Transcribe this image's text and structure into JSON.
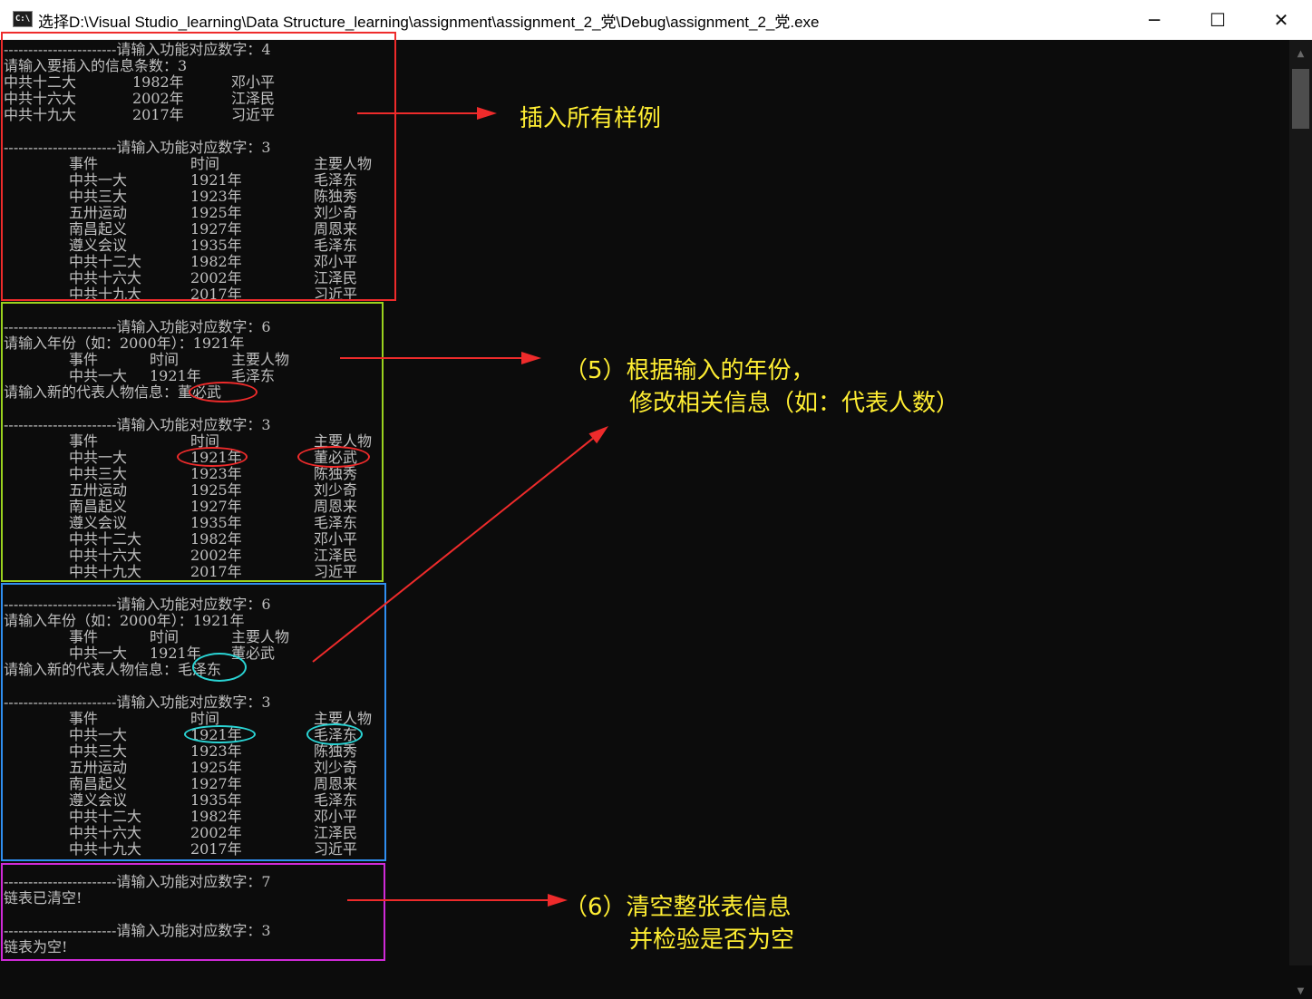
{
  "window": {
    "title": "选择D:\\Visual Studio_learning\\Data Structure_learning\\assignment\\assignment_2_党\\Debug\\assignment_2_党.exe",
    "icon": "console-app-icon",
    "minimize_glyph": "─",
    "maximize_glyph": "☐",
    "close_glyph": "✕"
  },
  "console": {
    "prompt_insert": "-----------------------请输入功能对应数字：4",
    "insert_count": "请输入要插入的信息条数：3",
    "inserted": [
      [
        "中共十二大",
        "1982年",
        "邓小平"
      ],
      [
        "中共十六大",
        "2002年",
        "江泽民"
      ],
      [
        "中共十九大",
        "2017年",
        "习近平"
      ]
    ],
    "prompt_list": "-----------------------请输入功能对应数字：3",
    "table_headers": [
      "事件",
      "时间",
      "主要人物"
    ],
    "table_original": [
      [
        "中共一大",
        "1921年",
        "毛泽东"
      ],
      [
        "中共三大",
        "1923年",
        "陈独秀"
      ],
      [
        "五卅运动",
        "1925年",
        "刘少奇"
      ],
      [
        "南昌起义",
        "1927年",
        "周恩来"
      ],
      [
        "遵义会议",
        "1935年",
        "毛泽东"
      ],
      [
        "中共十二大",
        "1982年",
        "邓小平"
      ],
      [
        "中共十六大",
        "2002年",
        "江泽民"
      ],
      [
        "中共十九大",
        "2017年",
        "习近平"
      ]
    ],
    "prompt_modify": "-----------------------请输入功能对应数字：6",
    "year_input": "请输入年份（如：2000年）：1921年",
    "found_row_before": [
      "中共一大",
      "1921年",
      "毛泽东"
    ],
    "new_person_prompt_1": "请输入新的代表人物信息：董必武",
    "table_modified": [
      [
        "中共一大",
        "1921年",
        "董必武"
      ],
      [
        "中共三大",
        "1923年",
        "陈独秀"
      ],
      [
        "五卅运动",
        "1925年",
        "刘少奇"
      ],
      [
        "南昌起义",
        "1927年",
        "周恩来"
      ],
      [
        "遵义会议",
        "1935年",
        "毛泽东"
      ],
      [
        "中共十二大",
        "1982年",
        "邓小平"
      ],
      [
        "中共十六大",
        "2002年",
        "江泽民"
      ],
      [
        "中共十九大",
        "2017年",
        "习近平"
      ]
    ],
    "found_row_after": [
      "中共一大",
      "1921年",
      "董必武"
    ],
    "new_person_prompt_2": "请输入新的代表人物信息：毛泽东",
    "prompt_clear": "-----------------------请输入功能对应数字：7",
    "cleared_msg": "链表已清空!",
    "empty_msg": "链表为空!"
  },
  "annotations": {
    "insert_note": "插入所有样例",
    "modify_note_line1": "（5）根据输入的年份，",
    "modify_note_line2": "修改相关信息（如：代表人数）",
    "clear_note_line1": "（6）清空整张表信息",
    "clear_note_line2": "并检验是否为空"
  },
  "colors": {
    "background": "#0c0c0c",
    "console_text": "#c0c0c0",
    "annotation_text": "#ffee33",
    "arrow": "#ee2b2b",
    "box_insert": "#ee2b2b",
    "box_modify": "#9ad21e",
    "box_restore": "#2f8ef0",
    "box_clear": "#d02ad8",
    "ring_red": "#ee2b2b",
    "ring_cyan": "#2ad4d4"
  }
}
